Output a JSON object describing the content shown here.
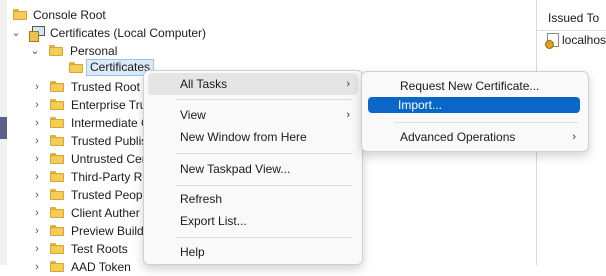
{
  "tree": {
    "root": "Console Root",
    "computer": "Certificates (Local Computer)",
    "personal": "Personal",
    "selected": "Certificates",
    "folders": [
      "Trusted Root C",
      "Enterprise Tru",
      "Intermediate C",
      "Trusted Publis",
      "Untrusted Cer",
      "Third-Party Ro",
      "Trusted Peopl",
      "Client Auther",
      "Preview Build",
      "Test Roots",
      "AAD Token"
    ]
  },
  "right_pane": {
    "column_header": "Issued To",
    "first_row": "localhos"
  },
  "context_menu": {
    "all_tasks": "All Tasks",
    "view": "View",
    "new_window": "New Window from Here",
    "new_taskpad": "New Taskpad View...",
    "refresh": "Refresh",
    "export_list": "Export List...",
    "help": "Help"
  },
  "submenu": {
    "request_new": "Request New Certificate...",
    "import": "Import...",
    "advanced": "Advanced Operations"
  },
  "colors": {
    "highlight": "#0a67c8",
    "hover": "#e5e5e5",
    "folder": "#f5cd56"
  }
}
